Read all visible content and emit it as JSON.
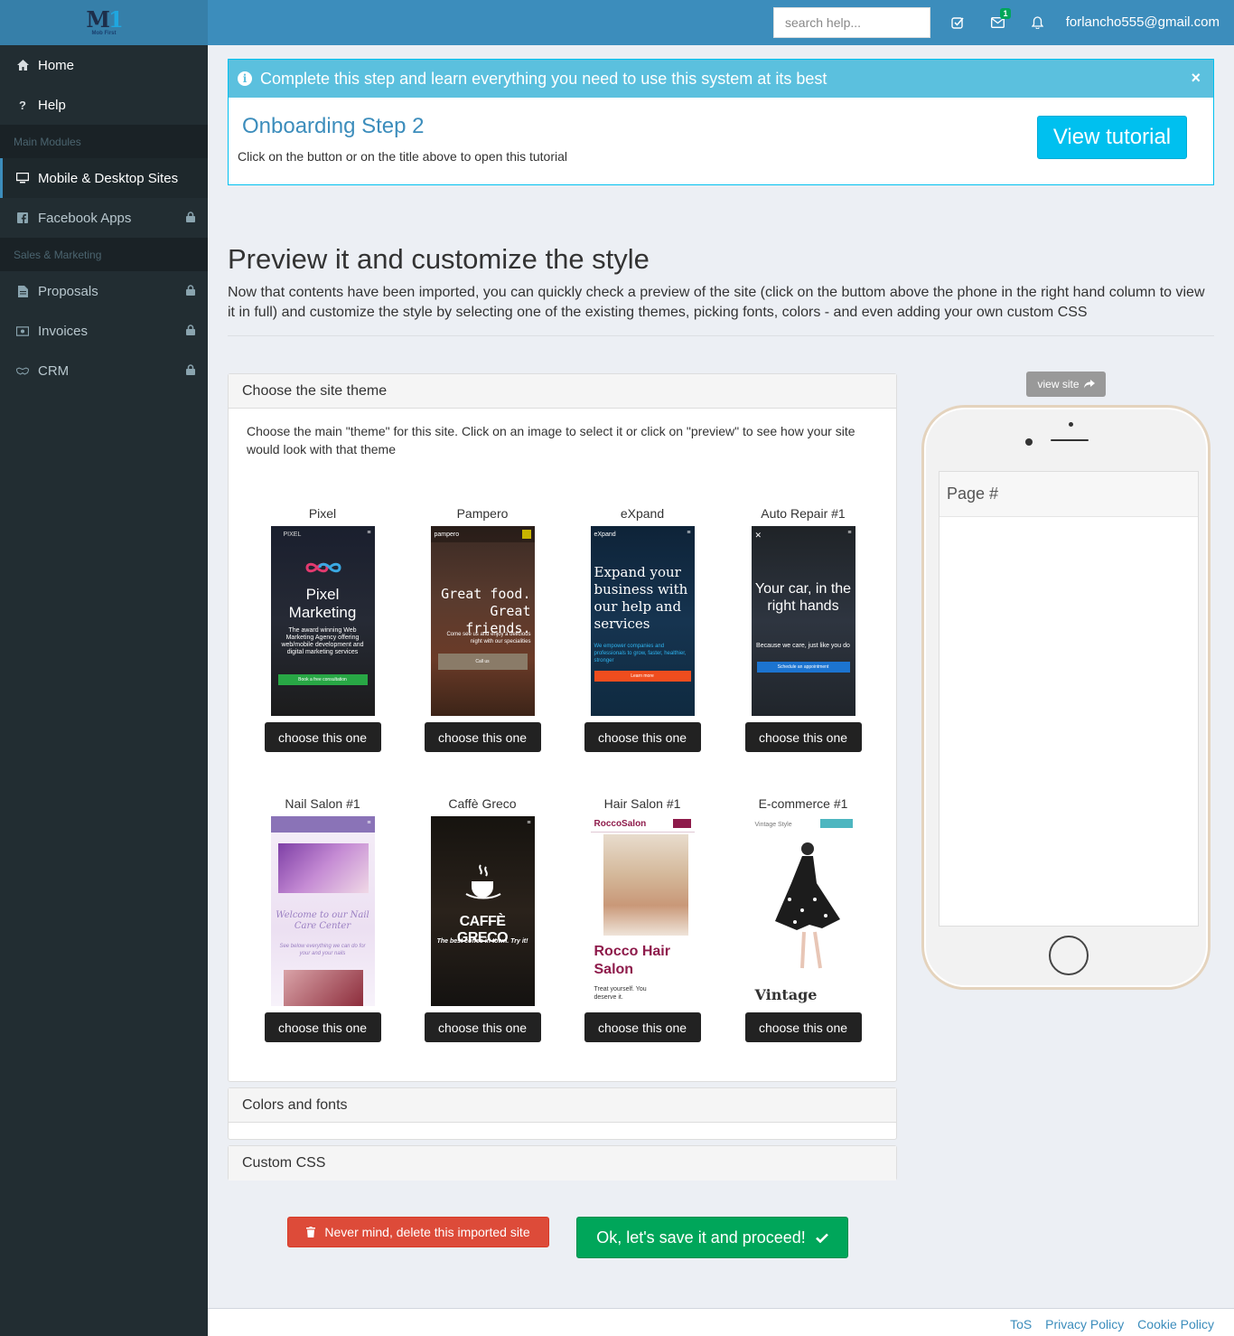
{
  "logo": {
    "text": "Mob First"
  },
  "sidebar": {
    "items": [
      {
        "label": "Home",
        "icon": "home-icon",
        "locked": false
      },
      {
        "label": "Help",
        "icon": "question-icon",
        "locked": false
      }
    ],
    "section1": "Main Modules",
    "modules": [
      {
        "label": "Mobile & Desktop Sites",
        "icon": "desktop-icon",
        "active": true
      },
      {
        "label": "Facebook Apps",
        "icon": "facebook-icon",
        "locked": true
      }
    ],
    "section2": "Sales & Marketing",
    "sales": [
      {
        "label": "Proposals",
        "icon": "file-icon",
        "locked": true
      },
      {
        "label": "Invoices",
        "icon": "money-icon",
        "locked": true
      },
      {
        "label": "CRM",
        "icon": "handshake-icon",
        "locked": true
      }
    ]
  },
  "topbar": {
    "search_placeholder": "search help...",
    "messages_badge": "1",
    "user_email": "forlancho555@gmail.com"
  },
  "onboarding": {
    "banner": "Complete this step and learn everything you need to use this system at its best",
    "close": "×",
    "title": "Onboarding Step 2",
    "description": "Click on the button or on the title above to open this tutorial",
    "button": "View tutorial"
  },
  "section": {
    "title": "Preview it and customize the style",
    "description": "Now that contents have been imported, you can quickly check a preview of the site (click on the buttom above the phone in the right hand column to view it in full) and customize the style by selecting one of the existing themes, picking fonts, colors - and even adding your own custom CSS"
  },
  "theme_panel": {
    "heading": "Choose the site theme",
    "intro": "Choose the main \"theme\" for this site. Click on an image to select it or click on \"preview\" to see how your site would look with that theme",
    "choose_label": "choose this one",
    "themes": [
      {
        "name": "Pixel",
        "headline": "Pixel Marketing",
        "brand": "PIXEL",
        "sub": "The award winning Web Marketing Agency offering web/mobile development and digital marketing services",
        "cta": "Book a free consultation"
      },
      {
        "name": "Pampero",
        "headline": "Great food. Great friends.",
        "brand": "pampero",
        "sub": "Come see us and enjoy a delicious night with our specialities",
        "cta": "Call us"
      },
      {
        "name": "eXpand",
        "headline": "Expand your business with our help and services",
        "brand": "eXpand",
        "sub": "We empower companies and professionals to grow, faster, healthier, stronger",
        "cta": "Learn more"
      },
      {
        "name": "Auto Repair #1",
        "headline": "Your car, in the right hands",
        "sub": "Because we care, just like you do",
        "cta": "Schedule an appointment"
      },
      {
        "name": "Nail Salon #1",
        "headline": "Welcome to our Nail Care Center",
        "sub": "See below everything we can do for your and your nails"
      },
      {
        "name": "Caffè Greco",
        "headline": "CAFFÈ GRECO",
        "sub": "The best coffee in town. Try it!"
      },
      {
        "name": "Hair Salon #1",
        "headline": "Rocco Hair Salon",
        "brand": "RoccoSalon",
        "sub": "Treat yourself. You deserve it."
      },
      {
        "name": "E-commerce #1",
        "headline": "Vintage",
        "brand": "Vintage Style"
      }
    ]
  },
  "colors_panel": {
    "heading": "Colors and fonts"
  },
  "css_panel": {
    "heading": "Custom CSS"
  },
  "actions": {
    "delete": "Never mind, delete this imported site",
    "proceed": "Ok, let's save it and proceed!"
  },
  "preview": {
    "view_site": "view site",
    "page_label": "Page #"
  },
  "footer": {
    "links": [
      "ToS",
      "Privacy Policy",
      "Cookie Policy"
    ]
  }
}
